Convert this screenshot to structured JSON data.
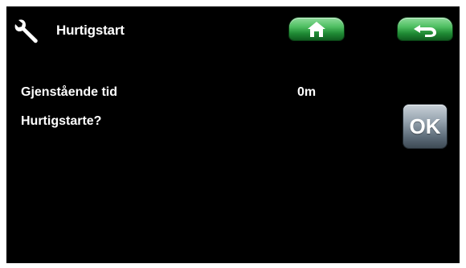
{
  "header": {
    "icon": "wrench-icon",
    "title": "Hurtigstart",
    "home_icon": "home-icon",
    "back_icon": "back-arrow-icon"
  },
  "main": {
    "remaining_label": "Gjenstående tid",
    "remaining_value": "0m",
    "quickstart_label": "Hurtigstarte?",
    "ok_label": "OK"
  },
  "colors": {
    "background": "#000000",
    "text": "#ffffff",
    "nav_button": "#2a9a3f",
    "ok_button": "#7a8894"
  }
}
